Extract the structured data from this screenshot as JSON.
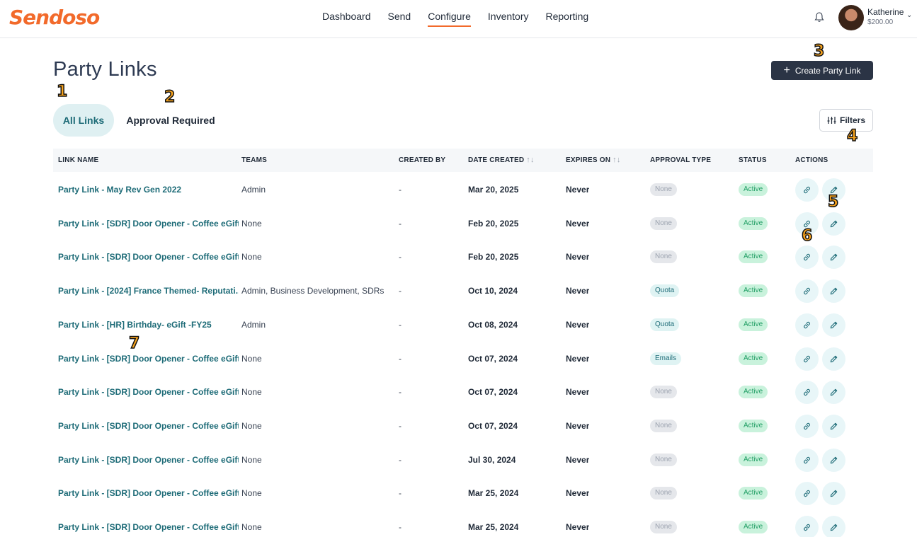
{
  "brand": {
    "logo_text": "Sendoso",
    "accent": "#f26a2b"
  },
  "nav": {
    "items": [
      "Dashboard",
      "Send",
      "Configure",
      "Inventory",
      "Reporting"
    ],
    "active": "Configure"
  },
  "user": {
    "name": "Katherine",
    "balance": "$200.00",
    "bell_icon": "bell-icon",
    "chevron_icon": "chevron-down-icon"
  },
  "page": {
    "title": "Party Links",
    "create_button": "Create Party Link",
    "filters_button": "Filters"
  },
  "tabs": [
    {
      "label": "All Links",
      "active": true
    },
    {
      "label": "Approval Required",
      "active": false
    }
  ],
  "markers": [
    "1",
    "2",
    "3",
    "4",
    "5",
    "6",
    "7"
  ],
  "table": {
    "headers": [
      "LINK NAME",
      "TEAMS",
      "CREATED BY",
      "DATE CREATED",
      "EXPIRES ON",
      "APPROVAL TYPE",
      "STATUS",
      "ACTIONS"
    ],
    "sort_glyph": "↑↓",
    "rows": [
      {
        "name": "Party Link - May Rev Gen 2022",
        "teams": "Admin",
        "created_by": "-",
        "date": "Mar 20, 2025",
        "expires": "Never",
        "approval": "None",
        "status": "Active"
      },
      {
        "name": "Party Link - [SDR] Door Opener - Coffee eGift...",
        "teams": "None",
        "created_by": "-",
        "date": "Feb 20, 2025",
        "expires": "Never",
        "approval": "None",
        "status": "Active"
      },
      {
        "name": "Party Link - [SDR] Door Opener - Coffee eGift...",
        "teams": "None",
        "created_by": "-",
        "date": "Feb 20, 2025",
        "expires": "Never",
        "approval": "None",
        "status": "Active"
      },
      {
        "name": "Party Link - [2024] France Themed- Reputati...",
        "teams": "Admin, Business Development, SDRs",
        "created_by": "-",
        "date": "Oct 10, 2024",
        "expires": "Never",
        "approval": "Quota",
        "status": "Active"
      },
      {
        "name": "Party Link - [HR] Birthday- eGift -FY25",
        "teams": "Admin",
        "created_by": "-",
        "date": "Oct 08, 2024",
        "expires": "Never",
        "approval": "Quota",
        "status": "Active"
      },
      {
        "name": "Party Link - [SDR] Door Opener - Coffee eGift...",
        "teams": "None",
        "created_by": "-",
        "date": "Oct 07, 2024",
        "expires": "Never",
        "approval": "Emails",
        "status": "Active"
      },
      {
        "name": "Party Link - [SDR] Door Opener - Coffee eGift...",
        "teams": "None",
        "created_by": "-",
        "date": "Oct 07, 2024",
        "expires": "Never",
        "approval": "None",
        "status": "Active"
      },
      {
        "name": "Party Link - [SDR] Door Opener - Coffee eGift...",
        "teams": "None",
        "created_by": "-",
        "date": "Oct 07, 2024",
        "expires": "Never",
        "approval": "None",
        "status": "Active"
      },
      {
        "name": "Party Link - [SDR] Door Opener - Coffee eGift...",
        "teams": "None",
        "created_by": "-",
        "date": "Jul 30, 2024",
        "expires": "Never",
        "approval": "None",
        "status": "Active"
      },
      {
        "name": "Party Link - [SDR] Door Opener - Coffee eGift...",
        "teams": "None",
        "created_by": "-",
        "date": "Mar 25, 2024",
        "expires": "Never",
        "approval": "None",
        "status": "Active"
      },
      {
        "name": "Party Link - [SDR] Door Opener - Coffee eGift...",
        "teams": "None",
        "created_by": "-",
        "date": "Mar 25, 2024",
        "expires": "Never",
        "approval": "None",
        "status": "Active"
      }
    ]
  }
}
